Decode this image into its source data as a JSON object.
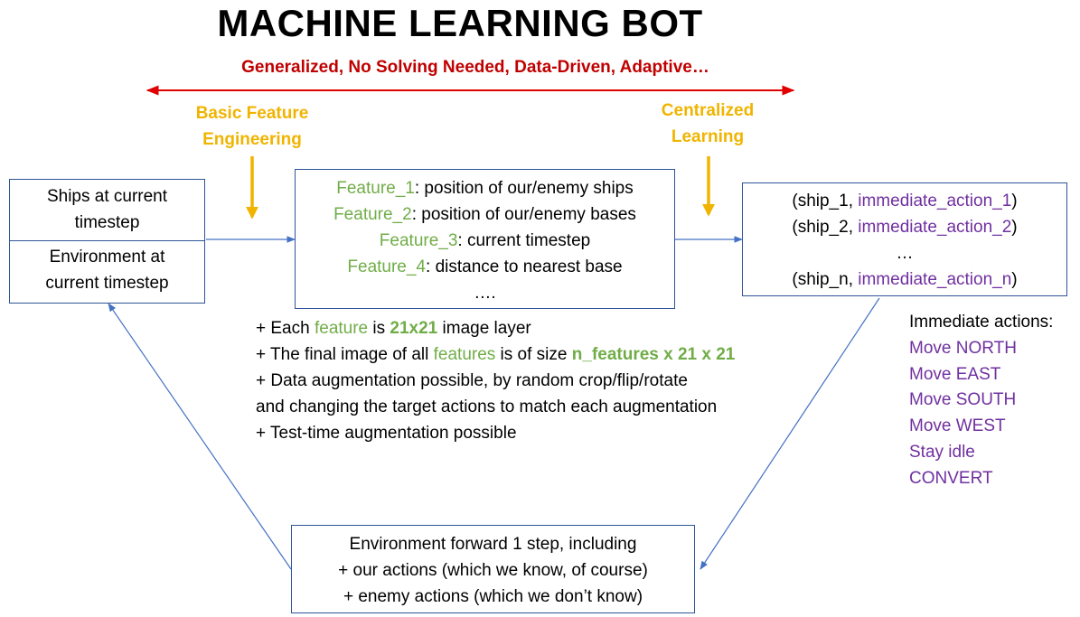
{
  "title": "MACHINE LEARNING BOT",
  "subtitle": "Generalized, No Solving Needed, Data-Driven, Adaptive…",
  "labels": {
    "basic_feature": [
      "Basic Feature",
      "Engineering"
    ],
    "centralized": [
      "Centralized",
      "Learning"
    ]
  },
  "left_box": {
    "top_lines": [
      "Ships at current",
      "timestep"
    ],
    "bottom_lines": [
      "Environment at",
      "current timestep"
    ]
  },
  "features_box": {
    "features": [
      {
        "name": "Feature_1",
        "desc": ": position of our/enemy ships"
      },
      {
        "name": "Feature_2",
        "desc": ": position of our/enemy bases"
      },
      {
        "name": "Feature_3",
        "desc": ": current timestep"
      },
      {
        "name": "Feature_4",
        "desc": ": distance to nearest base"
      }
    ],
    "ellipsis": "…."
  },
  "output_box": {
    "rows": [
      {
        "open": "(ship_1, ",
        "action": "immediate_action_1",
        "close": ")"
      },
      {
        "open": "(ship_2, ",
        "action": "immediate_action_2",
        "close": ")"
      }
    ],
    "ellipsis": "…",
    "last_row": {
      "open": "(ship_n, ",
      "action": "immediate_action_n",
      "close": ")"
    }
  },
  "notes": {
    "line1": {
      "prefix": "+ Each ",
      "feature": "feature",
      "mid": " is ",
      "size": "21x21",
      "suffix": " image layer"
    },
    "line2": {
      "prefix": "+ The final image of all ",
      "features": "features",
      "mid": " is of size ",
      "size": "n_features x 21 x 21"
    },
    "line3": "+ Data augmentation possible, by random crop/flip/rotate",
    "line4": "and changing the target actions to match each augmentation",
    "line5": "+ Test-time augmentation possible"
  },
  "immediate_actions": {
    "heading": "Immediate actions:",
    "items": [
      "Move NORTH",
      "Move EAST",
      "Move SOUTH",
      "Move WEST",
      "Stay idle",
      "CONVERT"
    ]
  },
  "bottom_box": {
    "lines": [
      "Environment forward 1 step, including",
      "+ our actions (which we know, of course)",
      "+ enemy actions (which we don’t know)"
    ]
  },
  "colors": {
    "title": "#000000",
    "subtitle": "#c00000",
    "orange": "#f0b400",
    "green": "#70ad47",
    "purple": "#7030a0",
    "border": "#2e5597",
    "red_arrow": "#e00000"
  }
}
